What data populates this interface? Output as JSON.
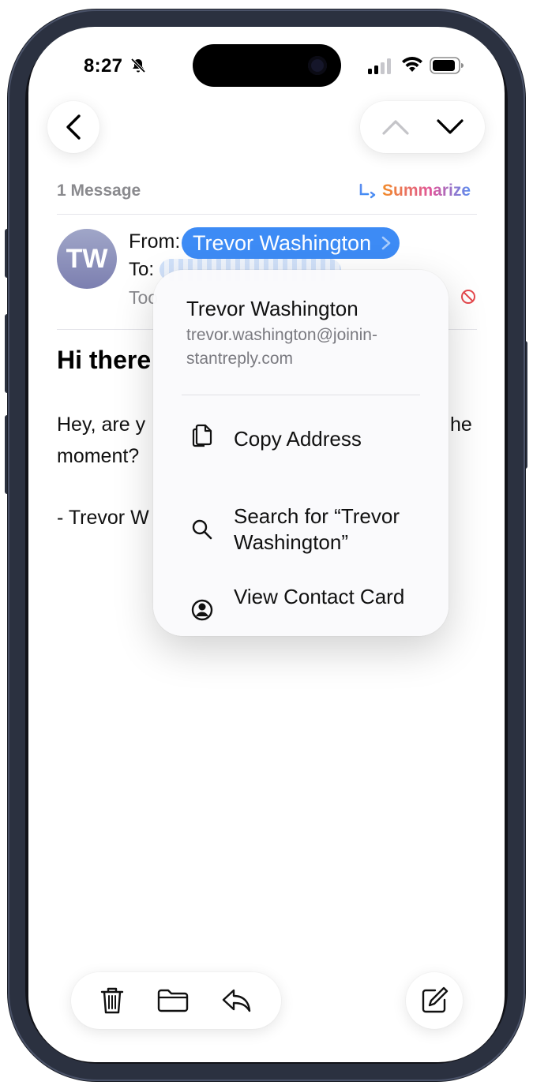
{
  "status": {
    "time": "8:27"
  },
  "nav": {
    "back_icon": "chevron-left-icon",
    "prev_icon": "chevron-up-icon",
    "next_icon": "chevron-down-icon"
  },
  "thread": {
    "message_count": "1 Message",
    "summarize_label": "Summarize"
  },
  "header": {
    "avatar_initials": "TW",
    "from_label": "From:",
    "sender_name": "Trevor Washington",
    "to_label": "To:",
    "date_fragment": "Too"
  },
  "message": {
    "subject": "Hi there",
    "body_line1": "Hey, are y",
    "body_line1_end": "he",
    "body_line2": "moment?",
    "signature": "- Trevor W"
  },
  "context_menu": {
    "name": "Trevor Washington",
    "email": "trevor.washington@joinin-stantreply.com",
    "items": [
      {
        "label": "Copy Address",
        "icon": "copy-doc-icon"
      },
      {
        "label": "Search for “Trevor Washington”",
        "icon": "magnifier-icon"
      },
      {
        "label": "View Contact Card",
        "icon": "person-circle-icon"
      }
    ]
  },
  "toolbar": {
    "trash_icon": "trash-icon",
    "folder_icon": "folder-icon",
    "reply_icon": "reply-icon",
    "compose_icon": "compose-icon"
  },
  "colors": {
    "accent_blue": "#3d8bf5",
    "summarize_gradient": [
      "#f28c28",
      "#e0569b",
      "#5b8df0"
    ],
    "secondary_text": "#8a8a8e",
    "block_red": "#e5484d"
  }
}
